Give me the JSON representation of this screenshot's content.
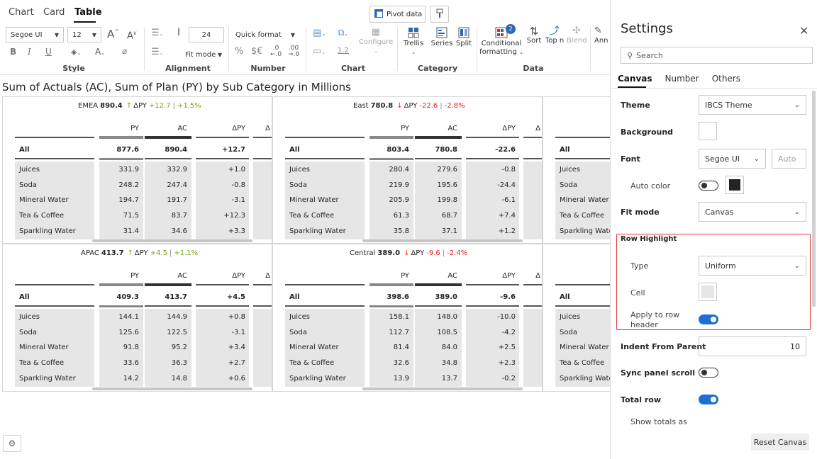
{
  "tabs": {
    "chart": "Chart",
    "card": "Card",
    "table": "Table"
  },
  "toolbar": {
    "pivot_label": "Pivot data",
    "font_family": "Segoe UI",
    "font_size": "12",
    "indent_value": "24",
    "quick_format": "Quick format",
    "fit_mode": "Fit mode",
    "number_ticks": "1.2",
    "configure": "Configure",
    "trellis": "Trellis",
    "series": "Series",
    "split": "Split",
    "conditional_formatting_1": "Conditional",
    "conditional_formatting_2": "formatting",
    "cf_badge": "2",
    "sort": "Sort",
    "topn": "Top n",
    "blend": "Blend",
    "annotate": "Ann",
    "groups": {
      "style": "Style",
      "alignment": "Alignment",
      "number": "Number",
      "chart": "Chart",
      "category": "Category",
      "data": "Data"
    }
  },
  "main_title": "Sum of Actuals (AC), Sum of Plan (PY) by Sub Category in Millions",
  "table_headers": {
    "py": "PY",
    "ac": "AC",
    "dpy": "ΔPY",
    "dpy_cut": "Δ"
  },
  "panels": [
    {
      "region": "EMEA",
      "value": "890.4",
      "arrow": "↑",
      "delta_label": "ΔPY",
      "delta_abs": "+12.7",
      "delta_pct": "+1.5%",
      "sep": "|",
      "all": {
        "label": "All",
        "py": "877.6",
        "ac": "890.4",
        "dpy": "+12.7"
      },
      "rows": [
        {
          "label": "Juices",
          "py": "331.9",
          "ac": "332.9",
          "dpy": "+1.0"
        },
        {
          "label": "Soda",
          "py": "248.2",
          "ac": "247.4",
          "dpy": "-0.8"
        },
        {
          "label": "Mineral Water",
          "py": "194.7",
          "ac": "191.7",
          "dpy": "-3.1"
        },
        {
          "label": "Tea & Coffee",
          "py": "71.5",
          "ac": "83.7",
          "dpy": "+12.3"
        },
        {
          "label": "Sparkling Water",
          "py": "31.4",
          "ac": "34.6",
          "dpy": "+3.3"
        }
      ]
    },
    {
      "region": "East",
      "value": "780.8",
      "arrow": "↓",
      "delta_label": "ΔPY",
      "delta_abs": "-22.6",
      "delta_pct": "-2.8%",
      "sep": "|",
      "all": {
        "label": "All",
        "py": "803.4",
        "ac": "780.8",
        "dpy": "-22.6"
      },
      "rows": [
        {
          "label": "Juices",
          "py": "280.4",
          "ac": "279.6",
          "dpy": "-0.8"
        },
        {
          "label": "Soda",
          "py": "219.9",
          "ac": "195.6",
          "dpy": "-24.4"
        },
        {
          "label": "Mineral Water",
          "py": "205.9",
          "ac": "199.8",
          "dpy": "-6.1"
        },
        {
          "label": "Tea & Coffee",
          "py": "61.3",
          "ac": "68.7",
          "dpy": "+7.4"
        },
        {
          "label": "Sparkling Water",
          "py": "35.8",
          "ac": "37.1",
          "dpy": "+1.2"
        }
      ]
    },
    {
      "region": "APAC",
      "value": "413.7",
      "arrow": "↑",
      "delta_label": "ΔPY",
      "delta_abs": "+4.5",
      "delta_pct": "+1.1%",
      "sep": "|",
      "all": {
        "label": "All",
        "py": "409.3",
        "ac": "413.7",
        "dpy": "+4.5"
      },
      "rows": [
        {
          "label": "Juices",
          "py": "144.1",
          "ac": "144.9",
          "dpy": "+0.8"
        },
        {
          "label": "Soda",
          "py": "125.6",
          "ac": "122.5",
          "dpy": "-3.1"
        },
        {
          "label": "Mineral Water",
          "py": "91.8",
          "ac": "95.2",
          "dpy": "+3.4"
        },
        {
          "label": "Tea & Coffee",
          "py": "33.6",
          "ac": "36.3",
          "dpy": "+2.7"
        },
        {
          "label": "Sparkling Water",
          "py": "14.2",
          "ac": "14.8",
          "dpy": "+0.6"
        }
      ]
    },
    {
      "region": "Central",
      "value": "389.0",
      "arrow": "↓",
      "delta_label": "ΔPY",
      "delta_abs": "-9.6",
      "delta_pct": "-2.4%",
      "sep": "|",
      "all": {
        "label": "All",
        "py": "398.6",
        "ac": "389.0",
        "dpy": "-9.6"
      },
      "rows": [
        {
          "label": "Juices",
          "py": "158.1",
          "ac": "148.0",
          "dpy": "-10.0"
        },
        {
          "label": "Soda",
          "py": "112.7",
          "ac": "108.5",
          "dpy": "-4.2"
        },
        {
          "label": "Mineral Water",
          "py": "81.4",
          "ac": "84.0",
          "dpy": "+2.5"
        },
        {
          "label": "Tea & Coffee",
          "py": "32.6",
          "ac": "34.8",
          "dpy": "+2.3"
        },
        {
          "label": "Sparkling Water",
          "py": "13.9",
          "ac": "13.7",
          "dpy": "-0.2"
        }
      ]
    }
  ],
  "partial_panel": {
    "all": "All",
    "rows": [
      "Juices",
      "Soda",
      "Mineral Water",
      "Tea & Coffee",
      "Sparkling Wate"
    ]
  },
  "settings": {
    "title": "Settings",
    "search_placeholder": "Search",
    "tabs": [
      "Canvas",
      "Number",
      "Others"
    ],
    "theme_label": "Theme",
    "theme_value": "IBCS Theme",
    "background_label": "Background",
    "font_label": "Font",
    "font_value": "Segoe UI",
    "font_size_placeholder": "Auto",
    "auto_color_label": "Auto color",
    "fit_mode_label": "Fit mode",
    "fit_mode_value": "Canvas",
    "row_highlight_label": "Row Highlight",
    "type_label": "Type",
    "type_value": "Uniform",
    "cell_label": "Cell",
    "apply_row_header_label_1": "Apply to row",
    "apply_row_header_label_2": "header",
    "indent_label": "Indent From Parent",
    "indent_value": "10",
    "sync_scroll_label": "Sync panel scroll",
    "total_row_label": "Total row",
    "show_totals_label": "Show totals as",
    "reset_label": "Reset Canvas"
  },
  "colors": {
    "accent": "#1f6fd0",
    "positive": "#7aa116",
    "negative": "#e4232a",
    "highlight_border": "#e0393e"
  }
}
